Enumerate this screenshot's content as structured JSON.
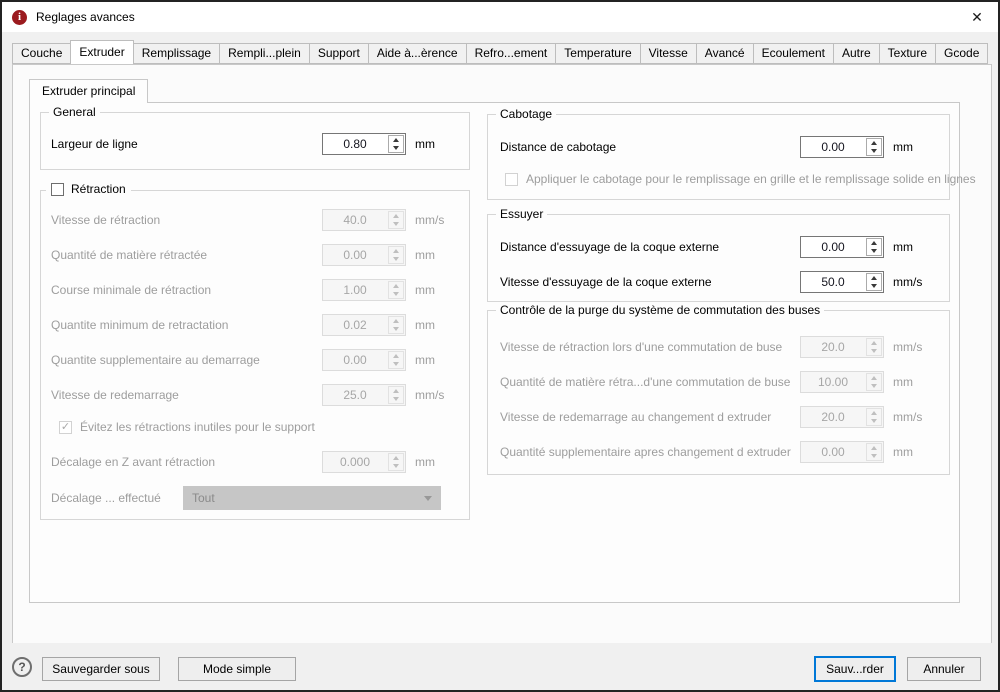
{
  "window": {
    "title": "Reglages avances",
    "close_glyph": "✕",
    "icon_letter": "i",
    "icon_color": "#9b1b1f"
  },
  "tabs": {
    "active_index": 1,
    "items": [
      "Couche",
      "Extruder",
      "Remplissage",
      "Rempli...plein",
      "Support",
      "Aide à...èrence",
      "Refro...ement",
      "Temperature",
      "Vitesse",
      "Avancé",
      "Ecoulement",
      "Autre",
      "Texture",
      "Gcode"
    ]
  },
  "subtab": {
    "label": "Extruder principal"
  },
  "general": {
    "title": "General",
    "row": {
      "label": "Largeur de ligne",
      "value": "0.80",
      "unit": "mm"
    }
  },
  "retraction": {
    "title": "Rétraction",
    "enabled": false,
    "rows": [
      {
        "label": "Vitesse de rétraction",
        "value": "40.0",
        "unit": "mm/s"
      },
      {
        "label": "Quantité de matière rétractée",
        "value": "0.00",
        "unit": "mm"
      },
      {
        "label": "Course minimale de rétraction",
        "value": "1.00",
        "unit": "mm"
      },
      {
        "label": "Quantite minimum de retractation",
        "value": "0.02",
        "unit": "mm"
      },
      {
        "label": "Quantite supplementaire au demarrage",
        "value": "0.00",
        "unit": "mm"
      },
      {
        "label": "Vitesse de redemarrage",
        "value": "25.0",
        "unit": "mm/s"
      }
    ],
    "avoid_checkbox": {
      "label": "Évitez les rétractions inutiles pour le support",
      "checked": true,
      "check_glyph": "✓"
    },
    "zhop_row": {
      "label": "Décalage en Z avant rétraction",
      "value": "0.000",
      "unit": "mm"
    },
    "combo_row": {
      "label": "Décalage ... effectué",
      "value": "Tout"
    }
  },
  "cabotage": {
    "title": "Cabotage",
    "row": {
      "label": "Distance de cabotage",
      "value": "0.00",
      "unit": "mm"
    },
    "checkbox": {
      "label": "Appliquer le cabotage pour le remplissage en grille et le remplissage solide en lignes",
      "checked": false
    }
  },
  "essuyer": {
    "title": "Essuyer",
    "rows": [
      {
        "label": "Distance d'essuyage de la coque externe",
        "value": "0.00",
        "unit": "mm"
      },
      {
        "label": "Vitesse d'essuyage de la coque externe",
        "value": "50.0",
        "unit": "mm/s"
      }
    ]
  },
  "purge": {
    "title": "Contrôle de la purge du système de commutation des buses",
    "rows": [
      {
        "label": "Vitesse de rétraction lors d'une commutation de buse",
        "value": "20.0",
        "unit": "mm/s"
      },
      {
        "label": "Quantité de matière rétra...d'une commutation de buse",
        "value": "10.00",
        "unit": "mm"
      },
      {
        "label": "Vitesse de redemarrage au changement d extruder",
        "value": "20.0",
        "unit": "mm/s"
      },
      {
        "label": "Quantité supplementaire apres changement d extruder",
        "value": "0.00",
        "unit": "mm"
      }
    ]
  },
  "footer": {
    "help_glyph": "?",
    "save_as": "Sauvegarder sous",
    "simple_mode": "Mode simple",
    "save": "Sauv...rder",
    "cancel": "Annuler"
  },
  "colors": {
    "accent": "#0078d7",
    "icon_red": "#9b1b1f"
  }
}
